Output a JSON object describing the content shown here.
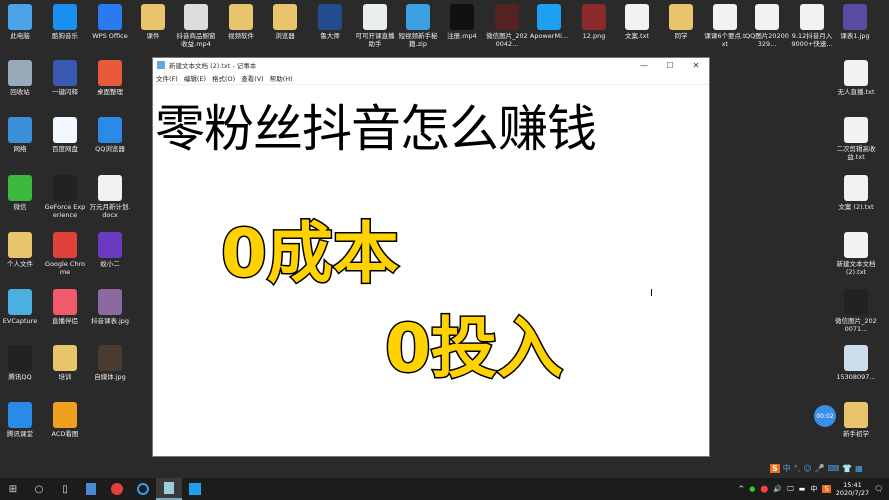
{
  "desktop": {
    "top_row": [
      {
        "label": "此电脑",
        "color": "#4aa3e8"
      },
      {
        "label": "酷狗音乐",
        "color": "#1a8ff0"
      },
      {
        "label": "WPS Office",
        "color": "#2a7af0"
      },
      {
        "label": "课件",
        "color": "#e8c46a"
      },
      {
        "label": "抖音商品橱窗收益.mp4",
        "color": "#ddd"
      },
      {
        "label": "视频软件",
        "color": "#e8c46a"
      },
      {
        "label": "浏览器",
        "color": "#e8c46a"
      },
      {
        "label": "鲁大师",
        "color": "#234c8c"
      },
      {
        "label": "可可开课直播助手",
        "color": "#e8f0ec"
      },
      {
        "label": "短视频新手秘籍.zip",
        "color": "#3aa0e0"
      },
      {
        "label": "注册.mp4",
        "color": "#111"
      },
      {
        "label": "微信图片_2020042...",
        "color": "#552222"
      },
      {
        "label": "ApowerMi...",
        "color": "#1ea0f0"
      },
      {
        "label": "12.png",
        "color": "#8a2a2a"
      },
      {
        "label": "文案.txt",
        "color": "#f2f2f2"
      },
      {
        "label": "同学",
        "color": "#e8c46a"
      },
      {
        "label": "课课6个要点.txt",
        "color": "#f2f2f2"
      },
      {
        "label": "QQ图片20200329...",
        "color": "#f2f2f2"
      },
      {
        "label": "9.12抖音月入9000+快速...",
        "color": "#f2f2f2"
      },
      {
        "label": "课表1.jpg",
        "color": "#5a4aa0"
      }
    ],
    "left_cols": [
      [
        {
          "label": "回收站",
          "color": "#9ab"
        },
        {
          "label": "网络",
          "color": "#3a8fd8"
        },
        {
          "label": "微信",
          "color": "#3cb83c"
        },
        {
          "label": "个人文件",
          "color": "#e8c46a"
        },
        {
          "label": "EVCapture",
          "color": "#4ab0e0"
        },
        {
          "label": "腾讯QQ",
          "color": "#222"
        },
        {
          "label": "腾讯课堂",
          "color": "#2a8ae8"
        }
      ],
      [
        {
          "label": "一键闪释",
          "color": "#3a5ab0"
        },
        {
          "label": "百度网盘",
          "color": "#f2f8ff"
        },
        {
          "label": "GeForce Experience",
          "color": "#222"
        },
        {
          "label": "Google Chrome",
          "color": "#e0413a"
        },
        {
          "label": "直播伴侣",
          "color": "#f05a6a"
        },
        {
          "label": "培训",
          "color": "#e8c46a"
        },
        {
          "label": "ACD看图",
          "color": "#f0a020"
        }
      ],
      [
        {
          "label": "桌面整理",
          "color": "#e85a3a"
        },
        {
          "label": "QQ浏览器",
          "color": "#2a8ae8"
        },
        {
          "label": "万元月新计划.docx",
          "color": "#f2f2f2"
        },
        {
          "label": "蚁小二",
          "color": "#6a3ac0"
        },
        {
          "label": "抖音课表.jpg",
          "color": "#8a6aa0"
        },
        {
          "label": "自媒体.jpg",
          "color": "#4a3a30"
        }
      ]
    ],
    "right_col": [
      {
        "label": "无人直播.txt",
        "color": "#f2f2f2"
      },
      {
        "label": "二次剪辑高收益.txt",
        "color": "#f2f2f2"
      },
      {
        "label": "文案 (2).txt",
        "color": "#f2f2f2"
      },
      {
        "label": "新建文本文档 (2).txt",
        "color": "#f2f2f2"
      },
      {
        "label": "微信图片_2020071...",
        "color": "#222"
      },
      {
        "label": "15308097...",
        "color": "#cde"
      },
      {
        "label": "新手初学",
        "color": "#e8c46a"
      }
    ],
    "recorder_badge": "00:02"
  },
  "notepad": {
    "title": "新建文本文档 (2).txt - 记事本",
    "controls": {
      "minimize": "—",
      "maximize": "☐",
      "close": "✕"
    },
    "menu": [
      "文件(F)",
      "编辑(E)",
      "格式(O)",
      "查看(V)",
      "帮助(H)"
    ],
    "line1": "零粉丝抖音怎么赚钱",
    "line2": "0成本",
    "line3": "0投入",
    "cursor": "I"
  },
  "ime_bar": [
    "S",
    "中",
    "°,",
    "☺",
    "🎤",
    "⌨",
    "👕",
    "▦"
  ],
  "taskbar": {
    "start": "⊞",
    "tray": [
      "^",
      "●",
      "⬤",
      "🔊",
      "🖵",
      "▬",
      "中",
      "S"
    ],
    "time": "15:41",
    "date": "2020/7/27",
    "notify": "🗨"
  },
  "colors": {
    "desktop": "#2a2a2a",
    "highlight_text": "#ffd200"
  }
}
